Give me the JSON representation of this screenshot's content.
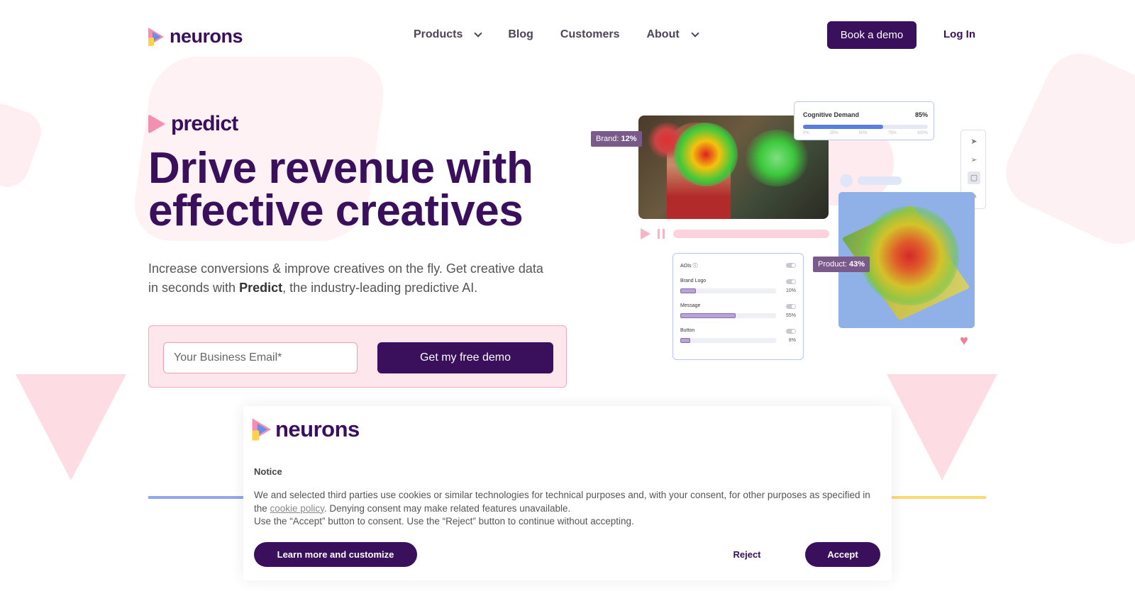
{
  "header": {
    "brand": "neurons",
    "nav": [
      {
        "label": "Products",
        "has_dropdown": true
      },
      {
        "label": "Blog",
        "has_dropdown": false
      },
      {
        "label": "Customers",
        "has_dropdown": false
      },
      {
        "label": "About",
        "has_dropdown": true
      }
    ],
    "book_demo_label": "Book a demo",
    "login_label": "Log In"
  },
  "hero": {
    "product_name": "predict",
    "headline_line1": "Drive revenue with",
    "headline_line2": "effective creatives",
    "subtitle_part1": "Increase conversions & improve creatives on the fly. Get creative data in seconds with ",
    "subtitle_bold": "Predict",
    "subtitle_part2": ", the industry-leading predictive AI.",
    "email_placeholder": "Your Business Email*",
    "cta_label": "Get my free demo"
  },
  "visual": {
    "brand_tag_label": "Brand: ",
    "brand_tag_value": "12%",
    "product_tag_label": "Product: ",
    "product_tag_value": "43%",
    "cognitive_label": "Cognitive Demand",
    "cognitive_value": "85%",
    "cognitive_fill": 0.64,
    "cognitive_ticks": [
      "0%",
      "25%",
      "50%",
      "75%",
      "100%"
    ],
    "aoi_header": "AOIs",
    "aois": [
      {
        "label": "Brand Logo",
        "value": "10%",
        "fill": 0.16
      },
      {
        "label": "Message",
        "value": "55%",
        "fill": 0.58
      },
      {
        "label": "Button",
        "value": "8%",
        "fill": 0.1
      }
    ],
    "heart_icon": "heart-icon"
  },
  "cookie": {
    "brand": "neurons",
    "title": "Notice",
    "text_part1": "We and selected third parties use cookies or similar technologies for technical purposes and, with your consent, for other purposes as specified in the ",
    "link_text": "cookie policy",
    "text_part2": ". Denying consent may make related features unavailable.",
    "text_line2": "Use the “Accept” button to consent. Use the “Reject” button to continue without accepting.",
    "learn_label": "Learn more and customize",
    "reject_label": "Reject",
    "accept_label": "Accept"
  },
  "colors": {
    "primary": "#3a0f5c",
    "pink": "#f48fb1",
    "blue": "#6b8fe6",
    "yellow": "#ffd24d"
  }
}
